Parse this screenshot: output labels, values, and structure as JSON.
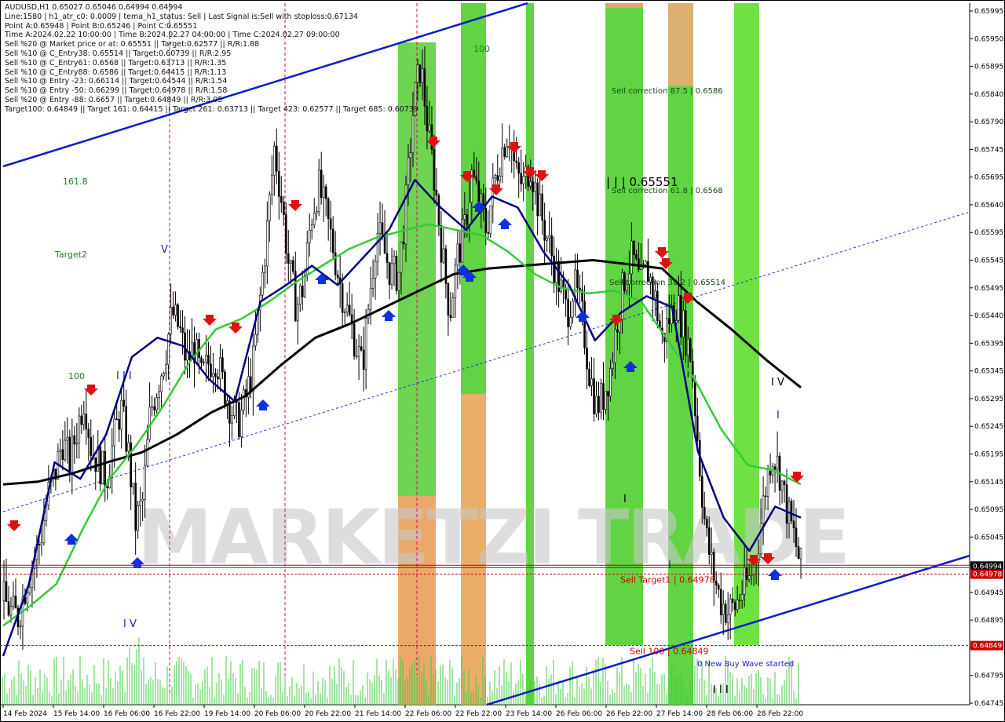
{
  "header": {
    "title": "AUDUSD,H1  0.65027 0.65046 0.64994 0.64994",
    "lines": [
      "Line:1580 | h1_atr_c0: 0.0009 | tema_h1_status: Sell | Last Signal is:Sell with stoploss:0.67134",
      "Point A:0.65948 | Point B:0.65246 | Point C:0.65551",
      "Time A:2024.02.22 10:00:00 | Time B:2024.02.27 04:00:00 | Time C:2024.02.27 09:00:00",
      "Sell %20 @ Market price or at: 0.65551 || Target:0.62577 || R/R:1.88",
      "Sell %10 @ C_Entry38: 0.65514 || Target:0.60739 || R/R:2.95",
      "Sell %10 @ C_Entry61: 0.6568 || Target:0.63713 || R/R:1.35",
      "Sell %10 @ C_Entry88: 0.6586 || Target:0.64415 || R/R:1.13",
      "Sell %10 @ Entry -23: 0.66114 || Target:0.64544 || R/R:1.54",
      "Sell %10 @ Entry -50: 0.66299 || Target:0.64978 || R/R:1.58",
      "Sell %20 @ Entry -88: 0.6657 || Target:0.64849 || R/R:3.05",
      "Target100: 0.64849 || Target 161: 0.64415 || Target 261: 0.63713 || Target 423: 0.62577 || Target 685: 0.60739"
    ]
  },
  "chart_data": {
    "type": "candlestick",
    "symbol": "AUDUSD",
    "timeframe": "H1",
    "ylim": [
      0.64745,
      0.65995
    ],
    "y_ticks": [
      "0.65995",
      "0.65950",
      "0.65895",
      "0.65840",
      "0.65790",
      "0.65745",
      "0.65695",
      "0.65640",
      "0.65595",
      "0.65545",
      "0.65495",
      "0.65440",
      "0.65395",
      "0.65345",
      "0.65295",
      "0.65245",
      "0.65195",
      "0.65145",
      "0.65095",
      "0.65045",
      "0.64995",
      "0.64945",
      "0.64895",
      "0.64845",
      "0.64795",
      "0.64745"
    ],
    "x_ticks": [
      "14 Feb 2024",
      "15 Feb 14:00",
      "16 Feb 06:00",
      "16 Feb 22:00",
      "19 Feb 14:00",
      "20 Feb 06:00",
      "20 Feb 22:00",
      "21 Feb 14:00",
      "22 Feb 06:00",
      "22 Feb 22:00",
      "23 Feb 14:00",
      "26 Feb 06:00",
      "26 Feb 22:00",
      "27 Feb 14:00",
      "28 Feb 06:00",
      "28 Feb 22:00"
    ],
    "close_path": [
      0.6493,
      0.6491,
      0.649,
      0.6496,
      0.65,
      0.6504,
      0.6512,
      0.6516,
      0.6522,
      0.6518,
      0.6524,
      0.653,
      0.652,
      0.6518,
      0.6515,
      0.6522,
      0.6528,
      0.652,
      0.6507,
      0.6511,
      0.6527,
      0.6532,
      0.6537,
      0.6545,
      0.6542,
      0.6536,
      0.6539,
      0.6533,
      0.6536,
      0.6537,
      0.6532,
      0.6528,
      0.6525,
      0.6529,
      0.6535,
      0.6547,
      0.656,
      0.6575,
      0.6565,
      0.6553,
      0.6546,
      0.655,
      0.6562,
      0.6568,
      0.6563,
      0.6557,
      0.655,
      0.6545,
      0.654,
      0.6535,
      0.6548,
      0.656,
      0.6556,
      0.6552,
      0.6552,
      0.6565,
      0.6582,
      0.659,
      0.6578,
      0.6568,
      0.6555,
      0.6545,
      0.6555,
      0.656,
      0.657,
      0.6565,
      0.656,
      0.6568,
      0.6574,
      0.6578,
      0.657,
      0.6568,
      0.6572,
      0.6565,
      0.656,
      0.6555,
      0.655,
      0.6545,
      0.655,
      0.6545,
      0.6535,
      0.6528,
      0.653,
      0.6535,
      0.6545,
      0.6552,
      0.6555,
      0.655,
      0.6553,
      0.6548,
      0.654,
      0.6544,
      0.6547,
      0.6542,
      0.6537,
      0.652,
      0.6505,
      0.6498,
      0.6493,
      0.6491,
      0.6492,
      0.6495,
      0.6497,
      0.6502,
      0.6512,
      0.652,
      0.6517,
      0.651,
      0.6505,
      0.6499
    ],
    "series": [
      {
        "name": "MA200",
        "color": "#000000",
        "values": [
          0.6514,
          0.65145,
          0.6516,
          0.6518,
          0.65198,
          0.6523,
          0.6527,
          0.653,
          0.65355,
          0.65405,
          0.6543,
          0.6546,
          0.6549,
          0.6552,
          0.6553,
          0.65535,
          0.6554,
          0.65545,
          0.65538,
          0.6553,
          0.6547,
          0.6542,
          0.65365,
          0.65315
        ]
      },
      {
        "name": "MA50",
        "color": "#33cc33",
        "values": [
          0.64885,
          0.6492,
          0.6496,
          0.6506,
          0.6515,
          0.6521,
          0.6528,
          0.6536,
          0.6542,
          0.6544,
          0.6547,
          0.65505,
          0.65535,
          0.65565,
          0.65585,
          0.65598,
          0.6561,
          0.656,
          0.6559,
          0.6556,
          0.6552,
          0.65495,
          0.65485,
          0.6549,
          0.6547,
          0.654,
          0.6533,
          0.6524,
          0.65175,
          0.65165,
          0.6514
        ]
      },
      {
        "name": "TEMA",
        "color": "#000080",
        "values": [
          0.6483,
          0.6496,
          0.6518,
          0.6515,
          0.6523,
          0.6537,
          0.65405,
          0.6539,
          0.6533,
          0.6529,
          0.6547,
          0.655,
          0.65535,
          0.655,
          0.6555,
          0.656,
          0.6569,
          0.6564,
          0.656,
          0.6566,
          0.6564,
          0.6556,
          0.655,
          0.654,
          0.6545,
          0.6548,
          0.6546,
          0.652,
          0.6508,
          0.6502,
          0.651,
          0.6508
        ]
      }
    ],
    "levels": [
      {
        "name": "Sell Target1",
        "value": 0.64978,
        "label": "Sell Target1 | 0.64978",
        "color": "#cc0000"
      },
      {
        "name": "Sell 100",
        "value": 0.64849,
        "label": "Sell 100 | 0.64849",
        "color": "#cc0000"
      },
      {
        "name": "current",
        "value": 0.64994,
        "label": "0.64994",
        "color": "#cc0000"
      }
    ],
    "annotations": [
      "Sell correction 87.5 | 0.6586",
      "Sell correction 61.8 | 0.6568",
      "Sell correction 38.2 | 0.65514",
      "| | | 0.65551",
      "0 New Buy Wave started",
      "161.8",
      "Target2",
      "100",
      "100",
      "V",
      "I I I",
      "I V",
      "I V",
      "I",
      "I",
      "I I I",
      "I"
    ],
    "watermark": "MARKETZI TRADE",
    "grid": false,
    "price_axis": "right"
  }
}
